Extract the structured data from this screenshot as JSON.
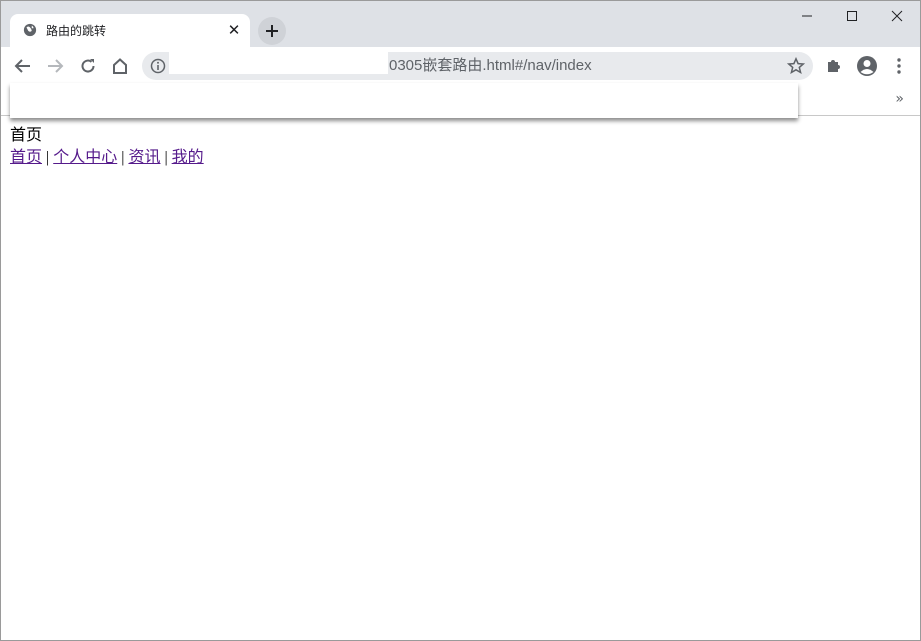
{
  "tab": {
    "title": "路由的跳转"
  },
  "address_bar": {
    "url": "0305嵌套路由.html#/nav/index"
  },
  "page": {
    "heading": "首页",
    "nav_links": [
      "首页",
      "个人中心",
      "资讯",
      "我的"
    ],
    "separator": "|"
  },
  "colors": {
    "tabstrip": "#dee1e6",
    "omnibox": "#e8eaed",
    "visited_link": "#551a8b"
  }
}
